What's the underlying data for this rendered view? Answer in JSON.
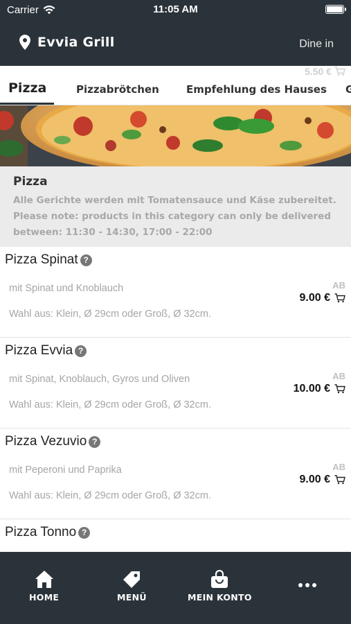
{
  "status_bar": {
    "carrier": "Carrier",
    "time": "11:05 AM"
  },
  "header": {
    "restaurant_name": "Evvia Grill",
    "mode": "Dine in"
  },
  "tabs": {
    "ghost_price": "5.50 €",
    "items": [
      {
        "label": "Pizza",
        "active": true
      },
      {
        "label": "Pizzabrötchen"
      },
      {
        "label": "Empfehlung des Hauses"
      },
      {
        "label": "G"
      }
    ]
  },
  "category": {
    "name": "Pizza",
    "description_lines": [
      "Alle Gerichte werden mit Tomatensauce und Käse zubereitet.",
      "Please note: products in this category can only be delivered",
      "between: 11:30 - 14:30, 17:00 - 22:00"
    ]
  },
  "products": [
    {
      "name": "Pizza Spinat",
      "description": "mit Spinat und Knoblauch",
      "options": "Wahl aus: Klein, Ø 29cm oder Groß, Ø 32cm.",
      "price_prefix": "AB",
      "price": "9.00 €"
    },
    {
      "name": "Pizza Evvia",
      "description": "mit Spinat, Knoblauch, Gyros und Oliven",
      "options": "Wahl aus: Klein, Ø 29cm oder Groß, Ø 32cm.",
      "price_prefix": "AB",
      "price": "10.00 €"
    },
    {
      "name": "Pizza Vezuvio",
      "description": "mit Peperoni und Paprika",
      "options": "Wahl aus: Klein, Ø 29cm oder Groß, Ø 32cm.",
      "price_prefix": "AB",
      "price": "9.00 €"
    },
    {
      "name": "Pizza Tonno"
    }
  ],
  "bottom_nav": [
    {
      "label": "HOME",
      "icon": "home-icon"
    },
    {
      "label": "MENÜ",
      "icon": "tag-icon"
    },
    {
      "label": "MEIN KONTO",
      "icon": "bag-icon"
    },
    {
      "label": "",
      "icon": "more-icon"
    }
  ],
  "colors": {
    "header_bg": "#2b333a",
    "category_bg": "#ebebeb",
    "muted_text": "#a5a5a5"
  }
}
